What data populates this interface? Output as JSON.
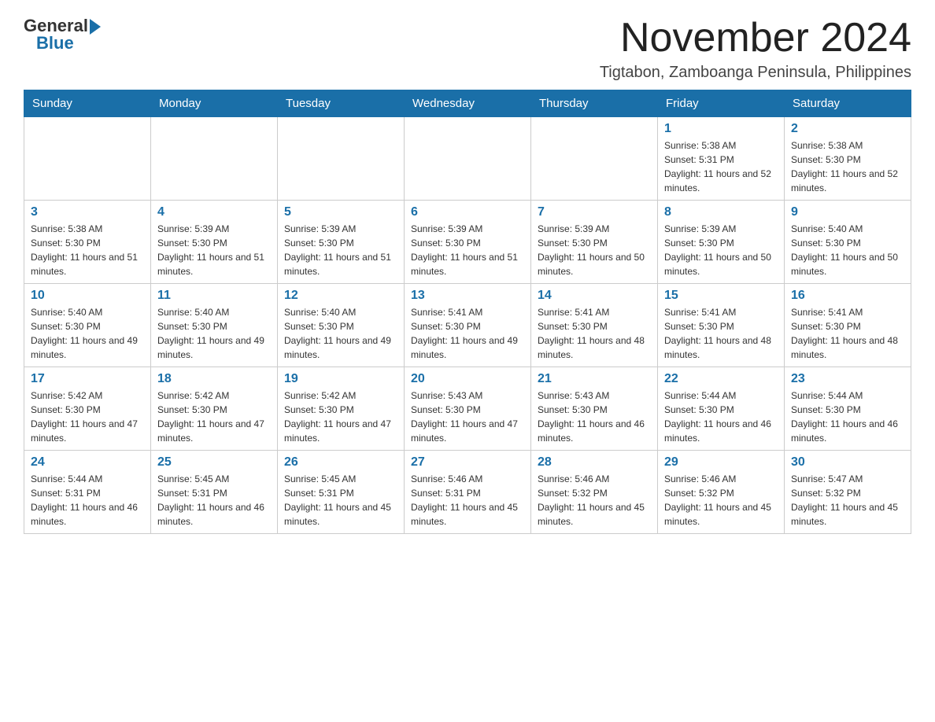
{
  "logo": {
    "general": "General",
    "blue": "Blue"
  },
  "header": {
    "month_year": "November 2024",
    "location": "Tigtabon, Zamboanga Peninsula, Philippines"
  },
  "days_of_week": [
    "Sunday",
    "Monday",
    "Tuesday",
    "Wednesday",
    "Thursday",
    "Friday",
    "Saturday"
  ],
  "weeks": [
    [
      {
        "day": "",
        "info": ""
      },
      {
        "day": "",
        "info": ""
      },
      {
        "day": "",
        "info": ""
      },
      {
        "day": "",
        "info": ""
      },
      {
        "day": "",
        "info": ""
      },
      {
        "day": "1",
        "info": "Sunrise: 5:38 AM\nSunset: 5:31 PM\nDaylight: 11 hours and 52 minutes."
      },
      {
        "day": "2",
        "info": "Sunrise: 5:38 AM\nSunset: 5:30 PM\nDaylight: 11 hours and 52 minutes."
      }
    ],
    [
      {
        "day": "3",
        "info": "Sunrise: 5:38 AM\nSunset: 5:30 PM\nDaylight: 11 hours and 51 minutes."
      },
      {
        "day": "4",
        "info": "Sunrise: 5:39 AM\nSunset: 5:30 PM\nDaylight: 11 hours and 51 minutes."
      },
      {
        "day": "5",
        "info": "Sunrise: 5:39 AM\nSunset: 5:30 PM\nDaylight: 11 hours and 51 minutes."
      },
      {
        "day": "6",
        "info": "Sunrise: 5:39 AM\nSunset: 5:30 PM\nDaylight: 11 hours and 51 minutes."
      },
      {
        "day": "7",
        "info": "Sunrise: 5:39 AM\nSunset: 5:30 PM\nDaylight: 11 hours and 50 minutes."
      },
      {
        "day": "8",
        "info": "Sunrise: 5:39 AM\nSunset: 5:30 PM\nDaylight: 11 hours and 50 minutes."
      },
      {
        "day": "9",
        "info": "Sunrise: 5:40 AM\nSunset: 5:30 PM\nDaylight: 11 hours and 50 minutes."
      }
    ],
    [
      {
        "day": "10",
        "info": "Sunrise: 5:40 AM\nSunset: 5:30 PM\nDaylight: 11 hours and 49 minutes."
      },
      {
        "day": "11",
        "info": "Sunrise: 5:40 AM\nSunset: 5:30 PM\nDaylight: 11 hours and 49 minutes."
      },
      {
        "day": "12",
        "info": "Sunrise: 5:40 AM\nSunset: 5:30 PM\nDaylight: 11 hours and 49 minutes."
      },
      {
        "day": "13",
        "info": "Sunrise: 5:41 AM\nSunset: 5:30 PM\nDaylight: 11 hours and 49 minutes."
      },
      {
        "day": "14",
        "info": "Sunrise: 5:41 AM\nSunset: 5:30 PM\nDaylight: 11 hours and 48 minutes."
      },
      {
        "day": "15",
        "info": "Sunrise: 5:41 AM\nSunset: 5:30 PM\nDaylight: 11 hours and 48 minutes."
      },
      {
        "day": "16",
        "info": "Sunrise: 5:41 AM\nSunset: 5:30 PM\nDaylight: 11 hours and 48 minutes."
      }
    ],
    [
      {
        "day": "17",
        "info": "Sunrise: 5:42 AM\nSunset: 5:30 PM\nDaylight: 11 hours and 47 minutes."
      },
      {
        "day": "18",
        "info": "Sunrise: 5:42 AM\nSunset: 5:30 PM\nDaylight: 11 hours and 47 minutes."
      },
      {
        "day": "19",
        "info": "Sunrise: 5:42 AM\nSunset: 5:30 PM\nDaylight: 11 hours and 47 minutes."
      },
      {
        "day": "20",
        "info": "Sunrise: 5:43 AM\nSunset: 5:30 PM\nDaylight: 11 hours and 47 minutes."
      },
      {
        "day": "21",
        "info": "Sunrise: 5:43 AM\nSunset: 5:30 PM\nDaylight: 11 hours and 46 minutes."
      },
      {
        "day": "22",
        "info": "Sunrise: 5:44 AM\nSunset: 5:30 PM\nDaylight: 11 hours and 46 minutes."
      },
      {
        "day": "23",
        "info": "Sunrise: 5:44 AM\nSunset: 5:30 PM\nDaylight: 11 hours and 46 minutes."
      }
    ],
    [
      {
        "day": "24",
        "info": "Sunrise: 5:44 AM\nSunset: 5:31 PM\nDaylight: 11 hours and 46 minutes."
      },
      {
        "day": "25",
        "info": "Sunrise: 5:45 AM\nSunset: 5:31 PM\nDaylight: 11 hours and 46 minutes."
      },
      {
        "day": "26",
        "info": "Sunrise: 5:45 AM\nSunset: 5:31 PM\nDaylight: 11 hours and 45 minutes."
      },
      {
        "day": "27",
        "info": "Sunrise: 5:46 AM\nSunset: 5:31 PM\nDaylight: 11 hours and 45 minutes."
      },
      {
        "day": "28",
        "info": "Sunrise: 5:46 AM\nSunset: 5:32 PM\nDaylight: 11 hours and 45 minutes."
      },
      {
        "day": "29",
        "info": "Sunrise: 5:46 AM\nSunset: 5:32 PM\nDaylight: 11 hours and 45 minutes."
      },
      {
        "day": "30",
        "info": "Sunrise: 5:47 AM\nSunset: 5:32 PM\nDaylight: 11 hours and 45 minutes."
      }
    ]
  ]
}
